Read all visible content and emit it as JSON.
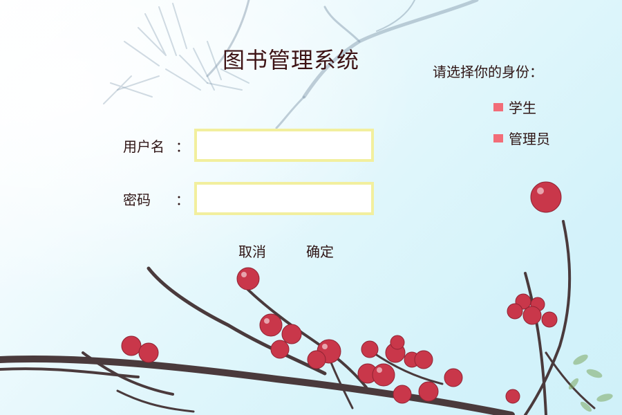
{
  "app": {
    "title": "图书管理系统"
  },
  "form": {
    "username_label": "用户名：",
    "username_label_text": "用户名",
    "password_label_text": "密码",
    "colon": "：",
    "username_value": "",
    "password_value": "",
    "cancel_label": "取消",
    "confirm_label": "确定"
  },
  "role": {
    "prompt": "请选择你的身份：",
    "options": [
      {
        "label": "学生"
      },
      {
        "label": "管理员"
      }
    ]
  },
  "colors": {
    "bullet": "#f26d78",
    "input_border": "#f2ef9e",
    "text": "#2f1515"
  }
}
